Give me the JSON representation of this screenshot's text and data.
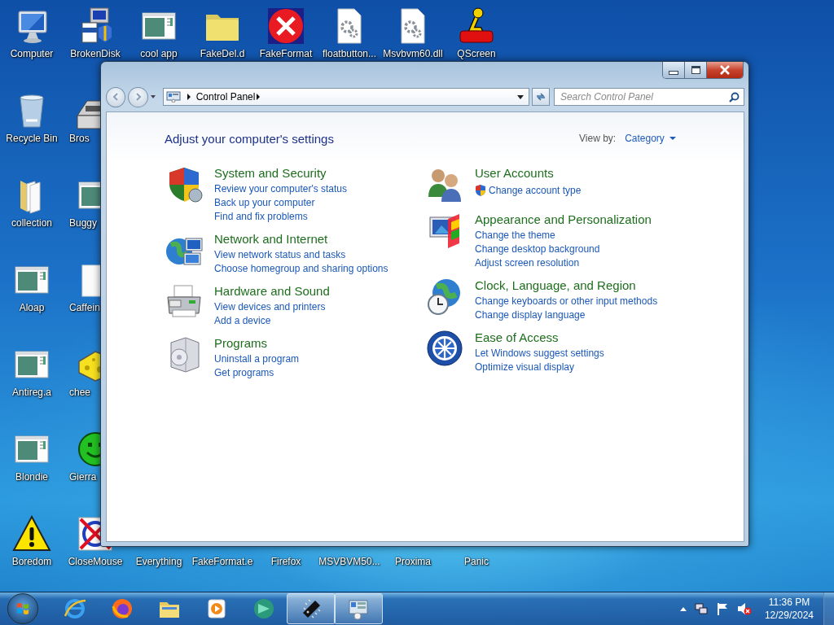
{
  "desktop": {
    "rows": [
      [
        {
          "label": "Computer",
          "kind": "computer",
          "clipped": false
        },
        {
          "label": "BrokenDisk",
          "kind": "installer",
          "clipped": false
        },
        {
          "label": "cool app",
          "kind": "appwin",
          "clipped": false
        },
        {
          "label": "FakeDel.d",
          "kind": "folder",
          "clipped": false
        },
        {
          "label": "FakeFormat",
          "kind": "error",
          "clipped": false
        },
        {
          "label": "floatbutton...",
          "kind": "gearfile",
          "clipped": false
        },
        {
          "label": "Msvbvm60.dll",
          "kind": "gearfile",
          "clipped": false
        },
        {
          "label": "QScreen",
          "kind": "runner",
          "clipped": false
        }
      ],
      [
        {
          "label": "Recycle Bin",
          "kind": "recycle",
          "clipped": false
        },
        {
          "label": "Bros",
          "kind": "scanner",
          "clipped": true
        }
      ],
      [
        {
          "label": "collection",
          "kind": "docs",
          "clipped": false
        },
        {
          "label": "Buggy",
          "kind": "appwin",
          "clipped": true
        }
      ],
      [
        {
          "label": "Aloap",
          "kind": "appwin",
          "clipped": false
        },
        {
          "label": "Caffein",
          "kind": "blank",
          "clipped": true
        }
      ],
      [
        {
          "label": "Antireg.a",
          "kind": "appwin",
          "clipped": false
        },
        {
          "label": "chee",
          "kind": "cheese",
          "clipped": true
        }
      ],
      [
        {
          "label": "Blondie",
          "kind": "appwin",
          "clipped": false
        },
        {
          "label": "Gierra",
          "kind": "smiley",
          "clipped": true
        }
      ],
      [
        {
          "label": "Boredom",
          "kind": "warning",
          "clipped": false
        },
        {
          "label": "CloseMouse",
          "kind": "nosign",
          "clipped": false
        },
        {
          "label": "Everything",
          "kind": "none",
          "clipped": false
        },
        {
          "label": "FakeFormat.e",
          "kind": "none",
          "clipped": false
        },
        {
          "label": "Firefox",
          "kind": "none",
          "clipped": false
        },
        {
          "label": "MSVBVM50...",
          "kind": "none",
          "clipped": false
        },
        {
          "label": "Proxima",
          "kind": "none",
          "clipped": false
        },
        {
          "label": "Panic",
          "kind": "none",
          "clipped": false
        }
      ]
    ]
  },
  "window": {
    "address": {
      "crumbs": [
        "Control Panel"
      ]
    },
    "search": {
      "placeholder": "Search Control Panel"
    },
    "heading": "Adjust your computer's settings",
    "view_by": {
      "label": "View by:",
      "value": "Category"
    },
    "columns": [
      [
        {
          "title": "System and Security",
          "kind": "shield",
          "links": [
            {
              "text": "Review your computer's status",
              "shield": false
            },
            {
              "text": "Back up your computer",
              "shield": false
            },
            {
              "text": "Find and fix problems",
              "shield": false
            }
          ]
        },
        {
          "title": "Network and Internet",
          "kind": "network",
          "links": [
            {
              "text": "View network status and tasks",
              "shield": false
            },
            {
              "text": "Choose homegroup and sharing options",
              "shield": false
            }
          ]
        },
        {
          "title": "Hardware and Sound",
          "kind": "printer",
          "links": [
            {
              "text": "View devices and printers",
              "shield": false
            },
            {
              "text": "Add a device",
              "shield": false
            }
          ]
        },
        {
          "title": "Programs",
          "kind": "programs",
          "links": [
            {
              "text": "Uninstall a program",
              "shield": false
            },
            {
              "text": "Get programs",
              "shield": false
            }
          ]
        }
      ],
      [
        {
          "title": "User Accounts",
          "kind": "users",
          "links": [
            {
              "text": "Change account type",
              "shield": true
            }
          ]
        },
        {
          "title": "Appearance and Personalization",
          "kind": "appearance",
          "links": [
            {
              "text": "Change the theme",
              "shield": false
            },
            {
              "text": "Change desktop background",
              "shield": false
            },
            {
              "text": "Adjust screen resolution",
              "shield": false
            }
          ]
        },
        {
          "title": "Clock, Language, and Region",
          "kind": "clock",
          "links": [
            {
              "text": "Change keyboards or other input methods",
              "shield": false
            },
            {
              "text": "Change display language",
              "shield": false
            }
          ]
        },
        {
          "title": "Ease of Access",
          "kind": "ease",
          "links": [
            {
              "text": "Let Windows suggest settings",
              "shield": false
            },
            {
              "text": "Optimize visual display",
              "shield": false
            }
          ]
        }
      ]
    ]
  },
  "taskbar": {
    "buttons": [
      {
        "kind": "ie",
        "highlighted": false
      },
      {
        "kind": "firefox",
        "highlighted": false
      },
      {
        "kind": "explorer",
        "highlighted": false
      },
      {
        "kind": "media",
        "highlighted": false
      },
      {
        "kind": "greenapp",
        "highlighted": false
      },
      {
        "kind": "chip",
        "highlighted": true
      },
      {
        "kind": "cpanel",
        "highlighted": true
      }
    ],
    "time": "11:36 PM",
    "date": "12/29/2024"
  }
}
